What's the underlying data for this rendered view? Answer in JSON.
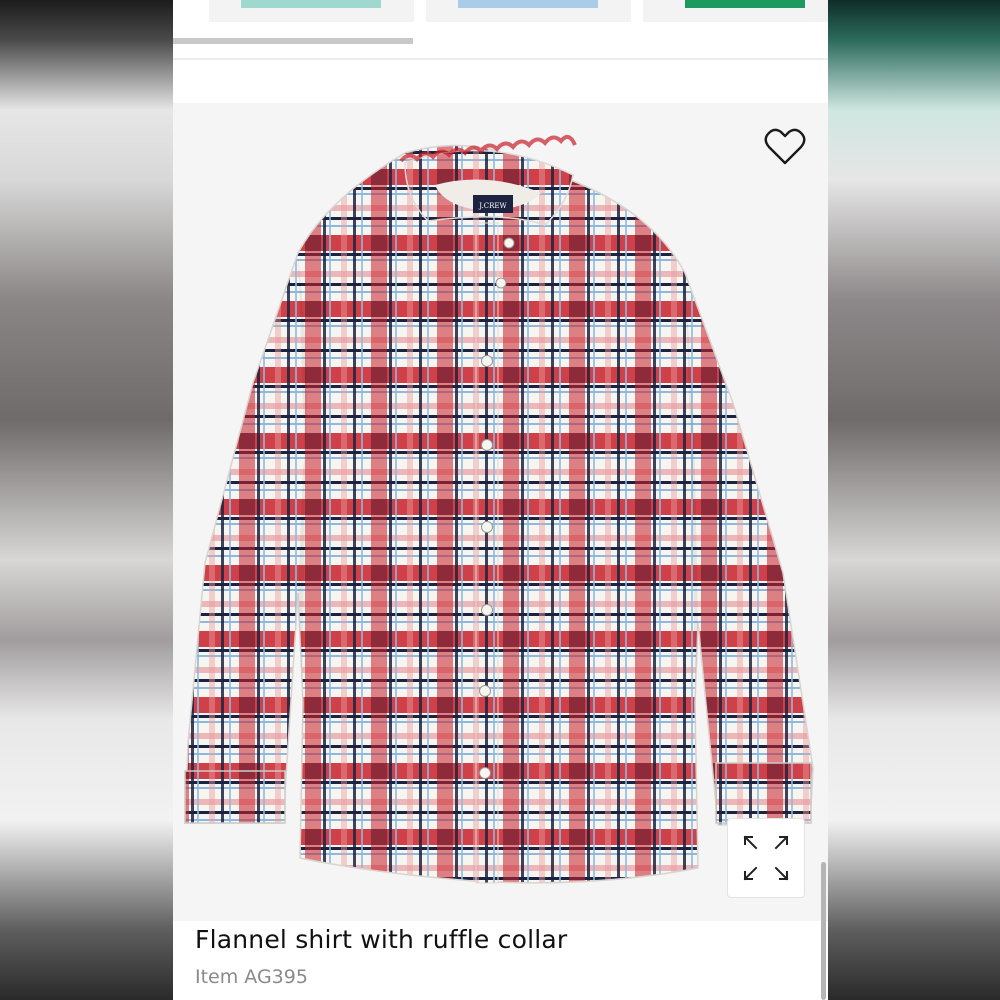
{
  "carousel": {
    "swatches": [
      {
        "color": "#9fd8cf",
        "label": "mint"
      },
      {
        "color": "#a9cde8",
        "label": "light-blue"
      },
      {
        "color": "#1e9a60",
        "label": "green"
      }
    ]
  },
  "product": {
    "title": "Flannel shirt with ruffle collar",
    "item_number": "Item AG395",
    "brand_label": "J.CREW",
    "plaid_colors": {
      "red": "#c8202a",
      "navy": "#1c2340",
      "white": "#f7f5f0",
      "light_blue": "#8fb8de",
      "pink": "#e99ca0"
    }
  },
  "icons": {
    "wishlist": "heart-icon",
    "zoom": "expand-icon"
  }
}
